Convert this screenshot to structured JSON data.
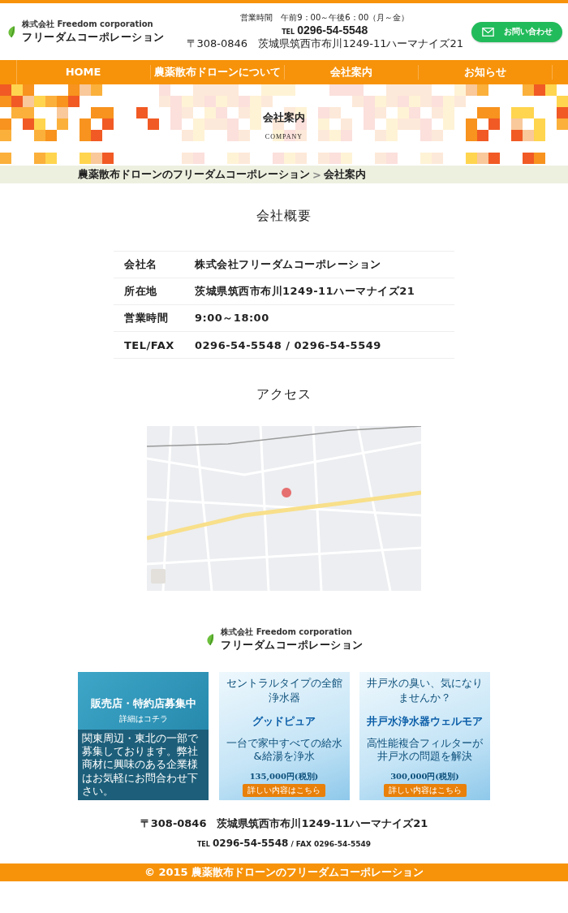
{
  "header": {
    "logo": {
      "kicker": "株式会社 Freedom corporation",
      "name": "フリーダムコーポレーション"
    },
    "hours": "営業時間　午前9：00～午後6：00（月～金）",
    "tel_label": "TEL",
    "tel": "0296-54-5548",
    "address": "〒308-0846　茨城県筑西市布川1249-11ハーマナイズ21",
    "contact_button": "お問い合わせ"
  },
  "nav": [
    {
      "label": "HOME"
    },
    {
      "label": "農薬散布ドローンについて"
    },
    {
      "label": "会社案内"
    },
    {
      "label": "お知らせ"
    }
  ],
  "hero": {
    "title": "会社案内",
    "subtitle": "COMPANY"
  },
  "breadcrumb": {
    "items": [
      "農薬散布ドローンのフリーダムコーポレーション",
      "会社案内"
    ],
    "separator": ">"
  },
  "overview": {
    "title": "会社概要",
    "rows": [
      {
        "label": "会社名",
        "value": "株式会社フリーダムコーポレーション"
      },
      {
        "label": "所在地",
        "value": "茨城県筑西市布川1249-11ハーマナイズ21"
      },
      {
        "label": "営業時間",
        "value": "9:00～18:00"
      },
      {
        "label": "TEL/FAX",
        "value": "0296-54-5548 / 0296-54-5549"
      }
    ]
  },
  "access": {
    "title": "アクセス"
  },
  "footer": {
    "logo": {
      "kicker": "株式会社 Freedom corporation",
      "name": "フリーダムコーポレーション"
    },
    "banners": [
      {
        "kind": "recruit",
        "headline": "販売店・特約店募集中",
        "link": "詳細はコチラ",
        "note": "関東周辺・東北の一部で募集しております。弊社商材に興味のある企業様はお気軽にお問合わせ下さい。"
      },
      {
        "kind": "product",
        "lead": "セントラルタイプの全館浄水器",
        "headline": "グッドピュア",
        "tagline": "一台で家中すべての給水&給湯を浄水",
        "price": "135,000円(税別)",
        "link": "詳しい内容はこちら"
      },
      {
        "kind": "product",
        "lead": "井戸水の臭い、気になりませんか？",
        "headline": "井戸水浄水器ウェルモア",
        "tagline": "高性能複合フィルターが井戸水の問題を解決",
        "price": "300,000円(税別)",
        "link": "詳しい内容はこちら"
      }
    ],
    "address": "〒308-0846　茨城県筑西市布川1249-11ハーマナイズ21",
    "tel_label": "TEL",
    "tel": "0296-54-5548",
    "fax": "/ FAX 0296-54-5549",
    "copyright": "© 2015 農薬散布ドローンのフリーダムコーポレーション"
  }
}
